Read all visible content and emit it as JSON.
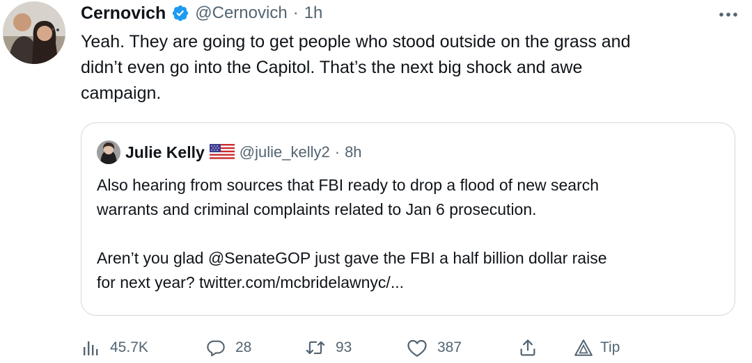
{
  "tweet": {
    "author_name": "Cernovich",
    "author_handle": "@Cernovich",
    "separator": "·",
    "time": "1h",
    "text": "Yeah. They are going to get people who stood outside on the grass and\ndidn’t even go into the Capitol. That’s the next big shock and awe\ncampaign.",
    "icons": {
      "verified": "verified-badge-icon",
      "more": "more-options-icon"
    }
  },
  "quoted_tweet": {
    "author_name": "Julie Kelly",
    "flag": "us-flag-icon",
    "author_handle": "@julie_kelly2",
    "separator": "·",
    "time": "8h",
    "text": "Also hearing from sources that FBI ready to drop a flood of new search\nwarrants and criminal complaints related to Jan 6 prosecution.\n\nAren’t you glad @SenateGOP just gave the FBI a half billion dollar raise\nfor next year? twitter.com/mcbridelawnyc/..."
  },
  "actions": {
    "views": "45.7K",
    "replies": "28",
    "retweets": "93",
    "likes": "387",
    "tip_label": "Tip"
  },
  "colors": {
    "text": "#0f1419",
    "secondary": "#536471",
    "verified": "#1d9bf0",
    "border": "#cfd9de"
  }
}
